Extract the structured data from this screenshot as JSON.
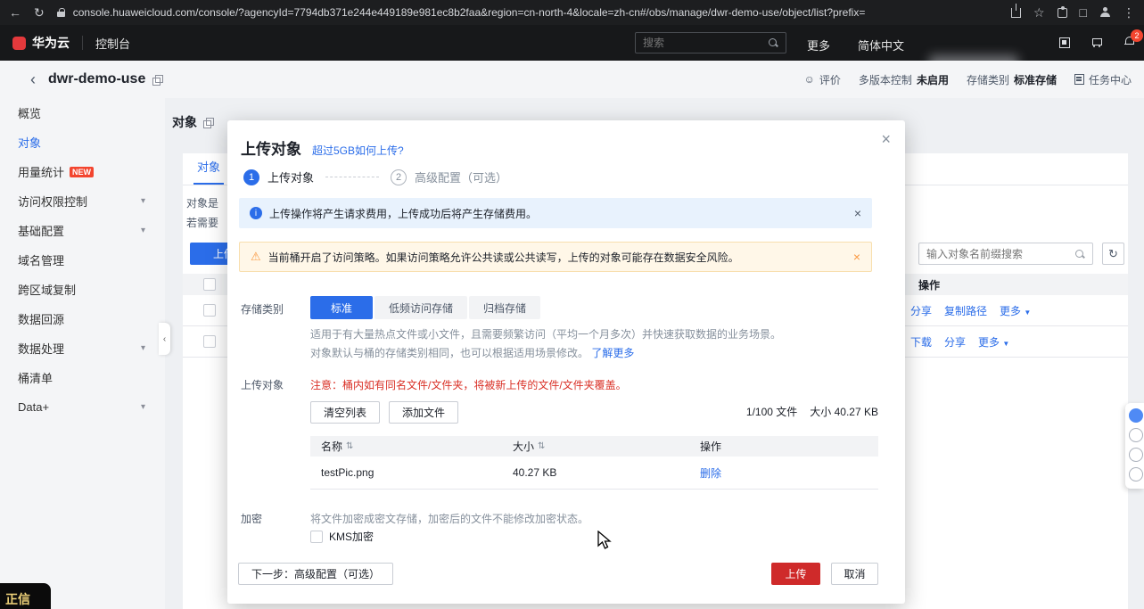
{
  "colors": {
    "accent": "#2b6de9",
    "danger": "#cf2a2a",
    "warning": "#fa9841",
    "badge_red": "#f3452f"
  },
  "browser": {
    "url": "console.huaweicloud.com/console/?agencyId=7794db371e244e449189e981ec8b2faa&region=cn-north-4&locale=zh-cn#/obs/manage/dwr-demo-use/object/list?prefix="
  },
  "topnav": {
    "logo": "华为云",
    "console": "控制台",
    "search_placeholder": "搜索",
    "more": "更多",
    "language": "简体中文",
    "bell_badge": "2"
  },
  "page_header": {
    "bucket_name": "dwr-demo-use",
    "feedback": "评价",
    "versioning_label": "多版本控制",
    "versioning_value": "未启用",
    "storage_label": "存储类别",
    "storage_value": "标准存储",
    "task_center": "任务中心"
  },
  "sidebar": {
    "items": [
      {
        "label": "概览"
      },
      {
        "label": "对象"
      },
      {
        "label": "用量统计",
        "badge": "NEW"
      },
      {
        "label": "访问权限控制"
      },
      {
        "label": "基础配置"
      },
      {
        "label": "域名管理"
      },
      {
        "label": "跨区域复制"
      },
      {
        "label": "数据回源"
      },
      {
        "label": "数据处理"
      },
      {
        "label": "桶清单"
      },
      {
        "label": "Data+"
      }
    ]
  },
  "content": {
    "page_title": "对象",
    "tab": "对象",
    "desc_fragment_1": "对象是",
    "desc_fragment_2": "若需要",
    "upload_button": "上传对象",
    "search_placeholder": "输入对象名前缀搜索",
    "ops_header": "操作",
    "row1_links": [
      "分享",
      "复制路径",
      "更多"
    ],
    "row2_links": [
      "下载",
      "分享",
      "更多"
    ]
  },
  "dialog": {
    "title": "上传对象",
    "help_link": "超过5GB如何上传?",
    "steps": [
      {
        "num": "1",
        "label": "上传对象"
      },
      {
        "num": "2",
        "label": "高级配置（可选）"
      }
    ],
    "info_banner": "上传操作将产生请求费用，上传成功后将产生存储费用。",
    "warning_banner": "当前桶开启了访问策略。如果访问策略允许公共读或公共读写，上传的对象可能存在数据安全风险。",
    "storage_class": {
      "label": "存储类别",
      "options": [
        "标准",
        "低频访问存储",
        "归档存储"
      ],
      "selected": "标准",
      "desc_line1": "适用于有大量热点文件或小文件，且需要频繁访问（平均一个月多次）并快速获取数据的业务场景。",
      "desc_line2": "对象默认与桶的存储类别相同，也可以根据适用场景修改。",
      "learn_more": "了解更多"
    },
    "upload_section": {
      "label": "上传对象",
      "note": "注意：桶内如有同名文件/文件夹，将被新上传的文件/文件夹覆盖。",
      "clear_list_button": "清空列表",
      "add_file_button": "添加文件",
      "file_count": "1/100 文件",
      "total_size": "大小 40.27 KB",
      "table": {
        "headers": [
          "名称",
          "大小",
          "操作"
        ],
        "rows": [
          {
            "name": "testPic.png",
            "size": "40.27 KB",
            "action": "删除"
          }
        ]
      }
    },
    "encryption": {
      "label": "加密",
      "desc": "将文件加密成密文存储，加密后的文件不能修改加密状态。",
      "kms_checkbox": "KMS加密"
    },
    "footer": {
      "next_button": "下一步：高级配置（可选）",
      "upload_button": "上传",
      "cancel_button": "取消"
    }
  },
  "corner_overlay": {
    "text": "正信"
  }
}
